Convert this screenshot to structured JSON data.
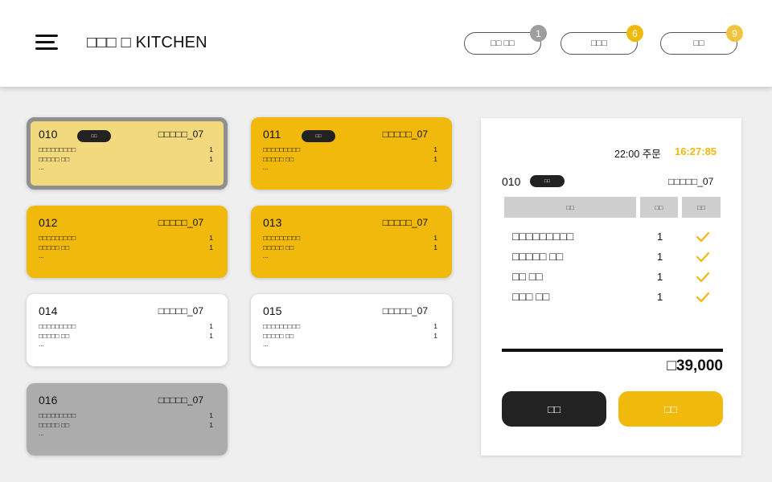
{
  "header": {
    "brand": "□□□ □ KITCHEN",
    "pills": [
      {
        "label": "□□ □□",
        "count": "1",
        "badge_color": "#9e9e9e"
      },
      {
        "label": "□□□",
        "count": "6",
        "badge_color": "#f0b90b"
      },
      {
        "label": "□□",
        "count": "9",
        "badge_color": "#f0c441"
      }
    ]
  },
  "colors": {
    "accent": "#f0b90b",
    "card_selected": "#f2d97e",
    "card_yellow": "#f0b90b",
    "card_white": "#ffffff",
    "card_gray": "#acacac",
    "check": "#f0b90b"
  },
  "orders": [
    {
      "num": "010",
      "tag": "□□",
      "table": "□□□□□_07",
      "state": "selected",
      "items": [
        {
          "name": "□□□□□□□□□",
          "qty": "1"
        },
        {
          "name": "□□□□□ □□",
          "qty": "1"
        }
      ],
      "more": "..."
    },
    {
      "num": "011",
      "tag": "□□",
      "table": "□□□□□_07",
      "state": "yellow",
      "items": [
        {
          "name": "□□□□□□□□□",
          "qty": "1"
        },
        {
          "name": "□□□□□ □□",
          "qty": "1"
        }
      ],
      "more": "..."
    },
    {
      "num": "012",
      "tag": "",
      "table": "□□□□□_07",
      "state": "yellow",
      "items": [
        {
          "name": "□□□□□□□□□",
          "qty": "1"
        },
        {
          "name": "□□□□□ □□",
          "qty": "1"
        }
      ],
      "more": "..."
    },
    {
      "num": "013",
      "tag": "",
      "table": "□□□□□_07",
      "state": "yellow",
      "items": [
        {
          "name": "□□□□□□□□□",
          "qty": "1"
        },
        {
          "name": "□□□□□ □□",
          "qty": "1"
        }
      ],
      "more": "..."
    },
    {
      "num": "014",
      "tag": "",
      "table": "□□□□□_07",
      "state": "white",
      "items": [
        {
          "name": "□□□□□□□□□",
          "qty": "1"
        },
        {
          "name": "□□□□□ □□",
          "qty": "1"
        }
      ],
      "more": "..."
    },
    {
      "num": "015",
      "tag": "",
      "table": "□□□□□_07",
      "state": "white",
      "items": [
        {
          "name": "□□□□□□□□□",
          "qty": "1"
        },
        {
          "name": "□□□□□ □□",
          "qty": "1"
        }
      ],
      "more": "..."
    },
    {
      "num": "016",
      "tag": "",
      "table": "□□□□□_07",
      "state": "gray",
      "items": [
        {
          "name": "□□□□□□□□□",
          "qty": "1"
        },
        {
          "name": "□□□□□ □□",
          "qty": "1"
        }
      ],
      "more": "..."
    }
  ],
  "detail": {
    "ordered_at": "22:00 주문",
    "elapsed": "16:27:85",
    "num": "010",
    "tag": "□□",
    "table": "□□□□□_07",
    "columns": [
      "□□",
      "□□",
      "□□"
    ],
    "items": [
      {
        "name": "□□□□□□□□□",
        "qty": "1",
        "done": true
      },
      {
        "name": "□□□□□ □□",
        "qty": "1",
        "done": true
      },
      {
        "name": "□□ □□",
        "qty": "1",
        "done": true
      },
      {
        "name": "□□□ □□",
        "qty": "1",
        "done": true
      }
    ],
    "total": "□39,000",
    "left_button": "□□",
    "right_button": "□□"
  }
}
